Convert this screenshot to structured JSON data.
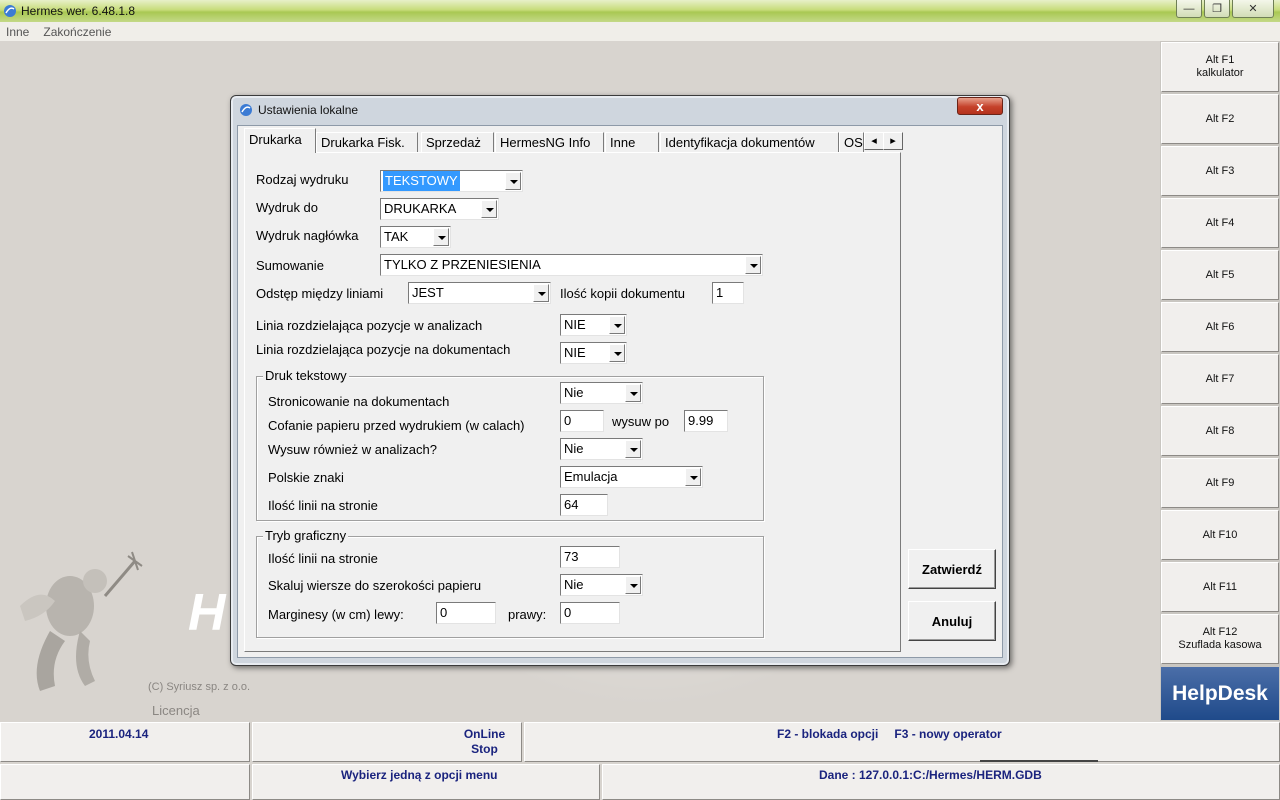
{
  "window": {
    "title": "Hermes wer. 6.48.1.8",
    "minimize_glyph": "—",
    "maximize_glyph": "❐",
    "close_glyph": "✕"
  },
  "menu": [
    "Inne",
    "Zakończenie"
  ],
  "background": {
    "logo_letters": "H",
    "copyright": "(C) Syriusz sp. z o.o.",
    "licencja": "Licencja"
  },
  "fkeys": [
    {
      "label": "Alt F1",
      "sub": "kalkulator"
    },
    {
      "label": "Alt F2",
      "sub": ""
    },
    {
      "label": "Alt F3",
      "sub": ""
    },
    {
      "label": "Alt F4",
      "sub": ""
    },
    {
      "label": "Alt F5",
      "sub": ""
    },
    {
      "label": "Alt F6",
      "sub": ""
    },
    {
      "label": "Alt F7",
      "sub": ""
    },
    {
      "label": "Alt F8",
      "sub": ""
    },
    {
      "label": "Alt F9",
      "sub": ""
    },
    {
      "label": "Alt F10",
      "sub": ""
    },
    {
      "label": "Alt F11",
      "sub": ""
    },
    {
      "label": "Alt F12",
      "sub": "Szuflada kasowa"
    }
  ],
  "helpdesk": "HelpDesk",
  "status": {
    "date": "2011.04.14",
    "online_line1": "OnLine",
    "online_line2": "Stop",
    "f2": "F2 - blokada opcji",
    "f3": "F3 - nowy operator",
    "message": "Wybierz jedną z opcji menu",
    "dane": "Dane  : 127.0.0.1:C:/Hermes/HERM.GDB"
  },
  "dialog": {
    "title": "Ustawienia lokalne",
    "close_glyph": "x",
    "tabs": [
      "Drukarka",
      "Drukarka Fisk.",
      "Sprzedaż",
      "HermesNG Info",
      "Inne",
      "Identyfikacja dokumentów",
      "OS"
    ],
    "tab_left_glyph": "◂",
    "tab_right_glyph": "▸",
    "fields": {
      "rodzaj_label": "Rodzaj wydruku",
      "rodzaj_value": "TEKSTOWY",
      "wydruk_do_label": "Wydruk do",
      "wydruk_do_value": "DRUKARKA",
      "naglowek_label": "Wydruk nagłówka",
      "naglowek_value": "TAK",
      "sumowanie_label": "Sumowanie",
      "sumowanie_value": "TYLKO Z PRZENIESIENIA",
      "odstep_label": "Odstęp między liniami",
      "odstep_value": "JEST",
      "kopie_label": "Ilość kopii dokumentu",
      "kopie_value": "1",
      "linia_analizy_label": "Linia rozdzielająca pozycje w analizach",
      "linia_analizy_value": "NIE",
      "linia_dok_label": "Linia rozdzielająca pozycje na dokumentach",
      "linia_dok_value": "NIE"
    },
    "druk_tekstowy": {
      "title": "Druk tekstowy",
      "stron_label": "Stronicowanie na dokumentach",
      "stron_value": "Nie",
      "cofanie_label": "Cofanie papieru przed wydrukiem (w calach)",
      "cofanie_value": "0",
      "wysuw_po_label": "wysuw po",
      "wysuw_po_value": "9.99",
      "wysuw_anal_label": "Wysuw również w analizach?",
      "wysuw_anal_value": "Nie",
      "polskie_label": "Polskie znaki",
      "polskie_value": "Emulacja",
      "linie_label": "Ilość linii na stronie",
      "linie_value": "64"
    },
    "tryb_graficzny": {
      "title": "Tryb graficzny",
      "linie_label": "Ilość linii na stronie",
      "linie_value": "73",
      "skaluj_label": "Skaluj wiersze do szerokości papieru",
      "skaluj_value": "Nie",
      "marg_label": "Marginesy (w cm)  lewy:",
      "marg_lewy_value": "0",
      "marg_prawy_label": "prawy:",
      "marg_prawy_value": "0"
    },
    "buttons": {
      "ok": "Zatwierdź",
      "cancel": "Anuluj"
    }
  }
}
